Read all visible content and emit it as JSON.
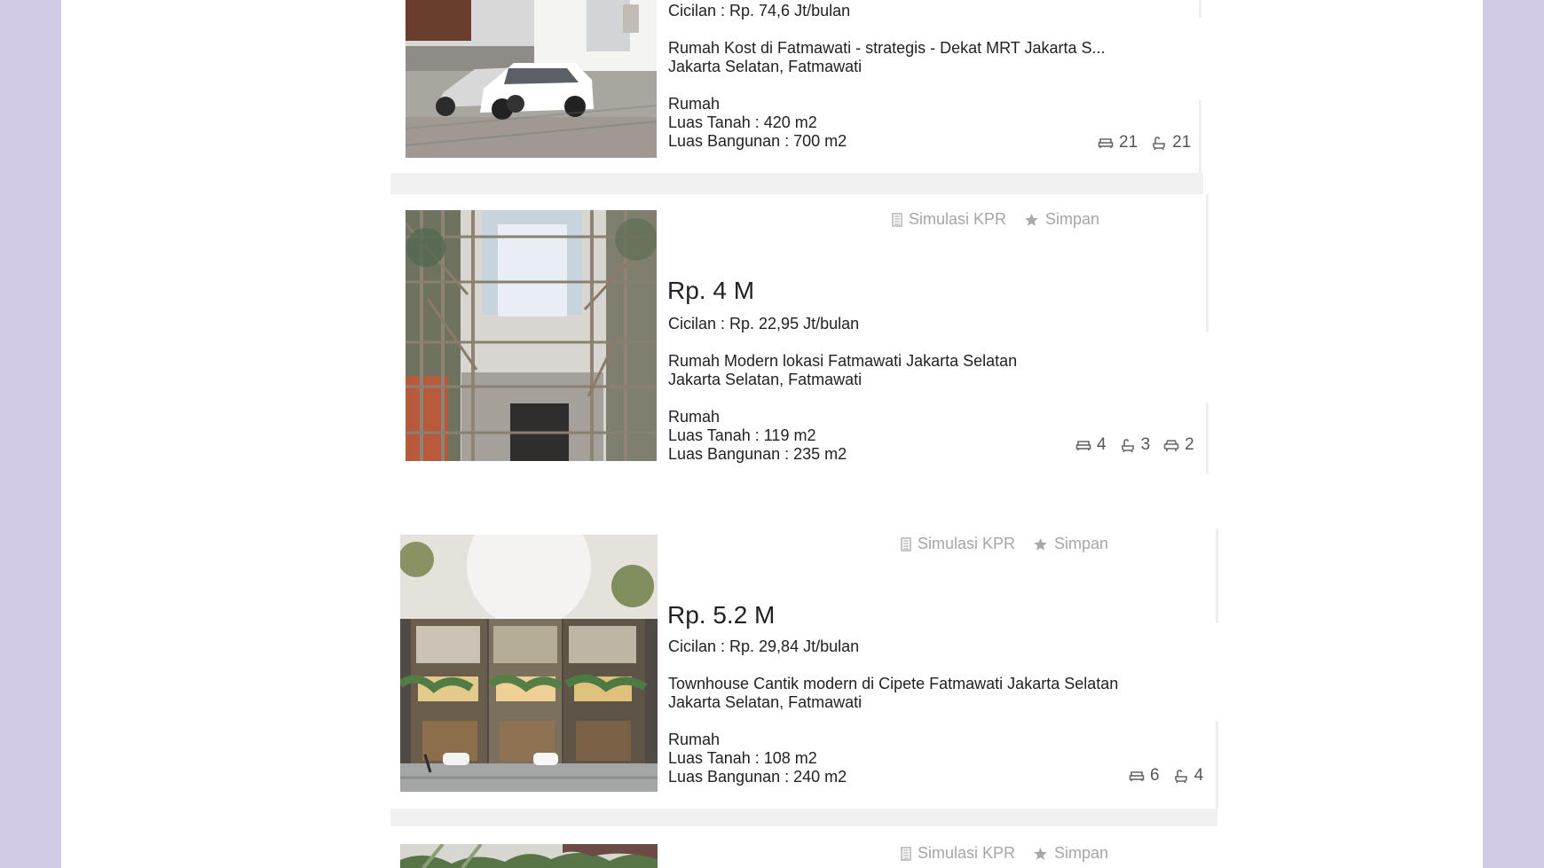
{
  "actions": {
    "simulation_label": "Simulasi KPR",
    "save_label": "Simpan"
  },
  "listings": [
    {
      "installment": "Cicilan : Rp. 74,6 Jt/bulan",
      "title": "Rumah Kost di Fatmawati - strategis - Dekat MRT Jakarta S...",
      "location": "Jakarta Selatan, Fatmawati",
      "type": "Rumah",
      "land_area": "Luas Tanah : 420 m2",
      "building_area": "Luas Bangunan : 700 m2",
      "bedrooms": "21",
      "bathrooms": "21"
    },
    {
      "price": "Rp. 4 M",
      "installment": "Cicilan : Rp. 22,95 Jt/bulan",
      "title": "Rumah Modern lokasi Fatmawati Jakarta Selatan",
      "location": "Jakarta Selatan, Fatmawati",
      "type": "Rumah",
      "land_area": "Luas Tanah : 119 m2",
      "building_area": "Luas Bangunan : 235 m2",
      "bedrooms": "4",
      "bathrooms": "3",
      "garages": "2"
    },
    {
      "price": "Rp. 5.2 M",
      "installment": "Cicilan : Rp. 29,84 Jt/bulan",
      "title": "Townhouse Cantik modern di Cipete Fatmawati Jakarta Selatan",
      "location": "Jakarta Selatan, Fatmawati",
      "type": "Rumah",
      "land_area": "Luas Tanah : 108 m2",
      "building_area": "Luas Bangunan : 240 m2",
      "bedrooms": "6",
      "bathrooms": "4"
    }
  ],
  "icons": {
    "bed": "bed-icon",
    "bath": "bath-icon",
    "car": "car-icon",
    "calculator": "calculator-icon",
    "star": "star-icon"
  },
  "colors": {
    "frame": "#d2cbe5",
    "page_background": "#ffffff",
    "divider": "#f0f0f0",
    "muted_text": "#a6a6a6",
    "primary_text": "#222222"
  }
}
